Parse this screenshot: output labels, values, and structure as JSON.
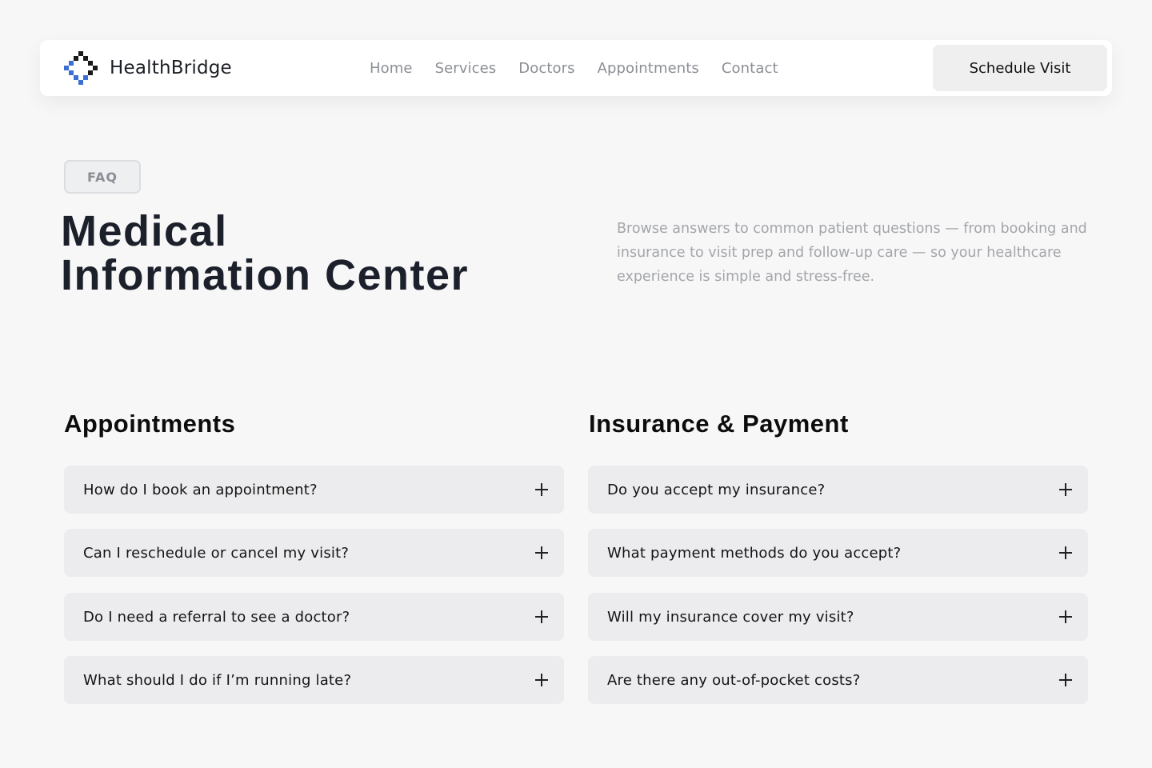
{
  "brand": {
    "name": "HealthBridge",
    "logo_icon": "diamond-cross-icon",
    "logo_colors": [
      "#1a1a1a",
      "#3b6fd4"
    ]
  },
  "nav": {
    "links": [
      "Home",
      "Services",
      "Doctors",
      "Appointments",
      "Contact"
    ],
    "cta_label": "Schedule Visit"
  },
  "hero": {
    "badge": "FAQ",
    "title_line1": "Medical",
    "title_line2": "Information Center",
    "description": "Browse answers to common patient questions — from booking and insurance to visit prep and follow-up care — so your healthcare experience is simple and stress-free."
  },
  "sections": {
    "appointments": {
      "title": "Appointments",
      "questions": [
        "How do I book an appointment?",
        "Can I reschedule or cancel my visit?",
        "Do I need a referral to see a doctor?",
        "What should I do if I’m running late?"
      ]
    },
    "insurance": {
      "title": "Insurance & Payment",
      "questions": [
        "Do you accept my insurance?",
        "What payment methods do you accept?",
        "Will my insurance cover my visit?",
        "Are there any out-of-pocket costs?"
      ]
    }
  },
  "icons": {
    "expand": "plus-icon"
  },
  "colors": {
    "background": "#f7f7f7",
    "card": "#ececee",
    "title": "#1b202b",
    "muted_text": "#a3a5aa",
    "accent_blue": "#3b6fd4"
  }
}
